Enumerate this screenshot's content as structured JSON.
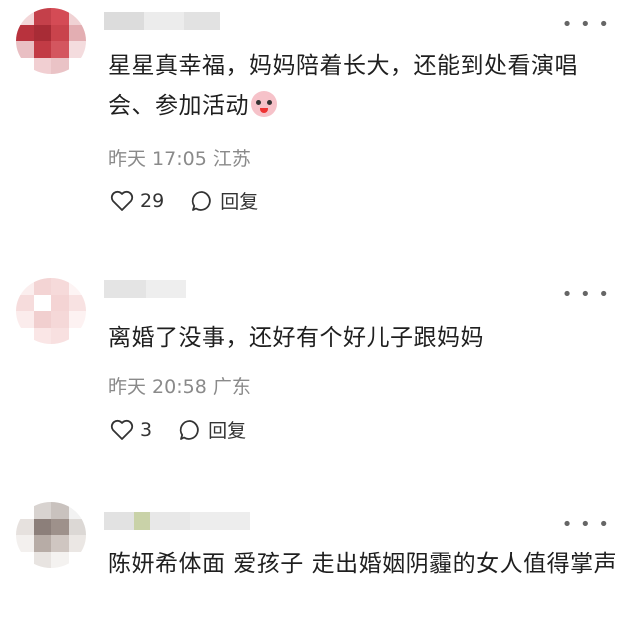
{
  "comments": [
    {
      "text": "星星真幸福，妈妈陪着长大，还能到处看演唱会、参加活动",
      "emoji": "crying-clown-emoji",
      "time": "昨天 17:05",
      "location": "江苏",
      "likes": "29",
      "reply_label": "回复"
    },
    {
      "text": "离婚了没事，还好有个好儿子跟妈妈",
      "time": "昨天 20:58",
      "location": "广东",
      "likes": "3",
      "reply_label": "回复"
    },
    {
      "text": "陈妍希体面 爱孩子 走出婚姻阴霾的女人值得掌声"
    }
  ],
  "icons": {
    "more": "more-dots-icon",
    "like": "heart-outline-icon",
    "reply": "comment-bubble-icon"
  },
  "colors": {
    "text": "#1f1f1f",
    "meta": "#8a8a8a"
  }
}
